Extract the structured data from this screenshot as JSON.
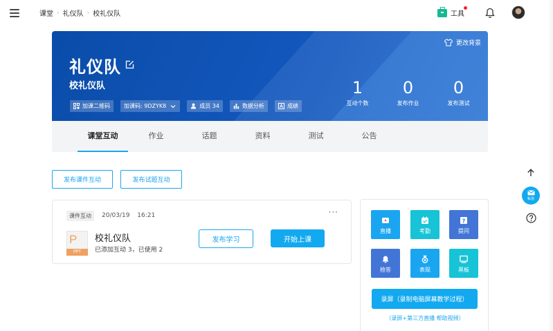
{
  "breadcrumb": [
    "课堂",
    "礼仪队",
    "校礼仪队"
  ],
  "header": {
    "tools_label": "工具"
  },
  "banner": {
    "change_bg_label": "更改背景",
    "class_name": "礼仪队",
    "school_name": "校礼仪队",
    "buttons": {
      "qrcode": "加课二维码",
      "code": "加课码: 9DZYK8",
      "members": "成员 34",
      "analysis": "数据分析",
      "grades": "成绩"
    },
    "stats": [
      {
        "value": "1",
        "label": "互动个数"
      },
      {
        "value": "0",
        "label": "发布作业"
      },
      {
        "value": "0",
        "label": "发布测试"
      }
    ]
  },
  "tabs": [
    "课堂互动",
    "作业",
    "话题",
    "资料",
    "测试",
    "公告"
  ],
  "actions": {
    "publish_courseware": "发布课件互动",
    "publish_quiz": "发布试题互动"
  },
  "card": {
    "tag": "课件互动",
    "date": "20/03/19",
    "time": "16:21",
    "file_type": "PPT",
    "title": "校礼仪队",
    "subtitle": "已添加互动 3，已使用 2",
    "btn_study": "发布学习",
    "btn_class": "开始上课"
  },
  "panel": {
    "tiles": [
      {
        "label": "直播",
        "icon": "live-icon",
        "color": "#1aa5f0"
      },
      {
        "label": "考勤",
        "icon": "attendance-icon",
        "color": "#17c3d6"
      },
      {
        "label": "提问",
        "icon": "question-icon",
        "color": "#4275d6"
      },
      {
        "label": "抢答",
        "icon": "bell-icon",
        "color": "#4275d6"
      },
      {
        "label": "表现",
        "icon": "medal-icon",
        "color": "#1aa5f0"
      },
      {
        "label": "黑板",
        "icon": "blackboard-icon",
        "color": "#17c3d6"
      }
    ],
    "record_label": "录屏（录制电脑屏幕教学过程）",
    "help_label": "（录屏+第三方直播 帮助视频）"
  },
  "side": {
    "message_label": "私信"
  }
}
